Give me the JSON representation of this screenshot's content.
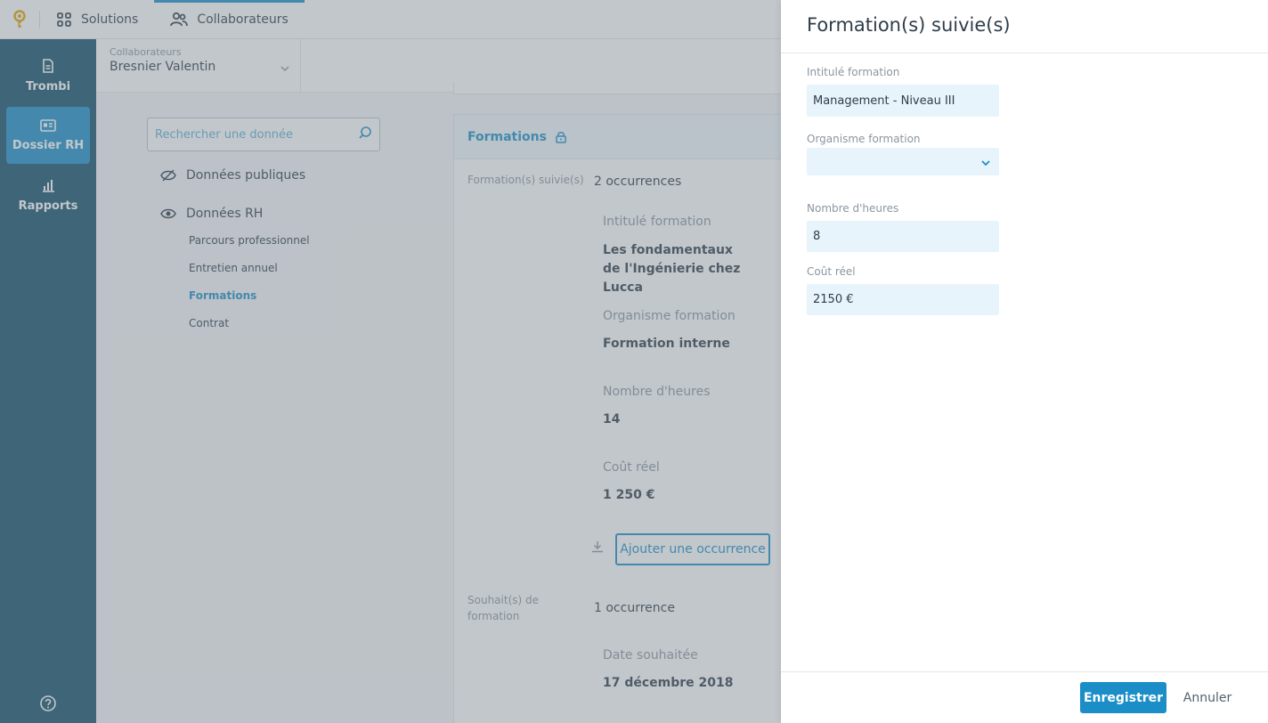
{
  "topbar": {
    "solutions_label": "Solutions",
    "collaborateurs_label": "Collaborateurs"
  },
  "sidebar": {
    "items": [
      {
        "label": "Trombi",
        "icon": "document-icon"
      },
      {
        "label": "Dossier RH",
        "icon": "id-card-icon",
        "active": true
      },
      {
        "label": "Rapports",
        "icon": "bar-chart-icon"
      }
    ],
    "help_icon": "help-icon"
  },
  "collaborator": {
    "label": "Collaborateurs",
    "value": "Bresnier Valentin"
  },
  "search": {
    "placeholder": "Rechercher une donnée"
  },
  "tree": {
    "public_label": "Données publiques",
    "rh_label": "Données RH",
    "items": [
      "Parcours professionnel",
      "Entretien annuel",
      "Formations",
      "Contrat"
    ],
    "active_item": "Formations"
  },
  "card": {
    "title": "Formations",
    "suivies_label": "Formation(s) suivie(s)",
    "suivies_count": "2 occurrences",
    "entry": {
      "intitule_label": "Intitulé formation",
      "intitule_value": "Les fondamentaux de l'Ingénierie chez Lucca",
      "organisme_label": "Organisme formation",
      "organisme_value": "Formation interne",
      "heures_label": "Nombre d'heures",
      "heures_value": "14",
      "cout_label": "Coût réel",
      "cout_value": "1 250 €"
    },
    "add_button": "Ajouter une occurrence",
    "souhaits_label": "Souhait(s) de formation",
    "souhaits_count": "1 occurrence",
    "souhait_entry": {
      "date_label": "Date souhaitée",
      "date_value": "17 décembre 2018"
    }
  },
  "panel": {
    "title": "Formation(s) suivie(s)",
    "intitule_label": "Intitulé formation",
    "intitule_value": "Management - Niveau III",
    "organisme_label": "Organisme formation",
    "organisme_value": "",
    "heures_label": "Nombre d'heures",
    "heures_value": "8",
    "cout_label": "Coût réel",
    "cout_value": "2150 €",
    "save_label": "Enregistrer",
    "cancel_label": "Annuler"
  },
  "colors": {
    "primary": "#1b8ec8",
    "sidebar_bg": "#0f4d69",
    "field_bg": "#e8f4fc",
    "logo": "#e0a400"
  }
}
